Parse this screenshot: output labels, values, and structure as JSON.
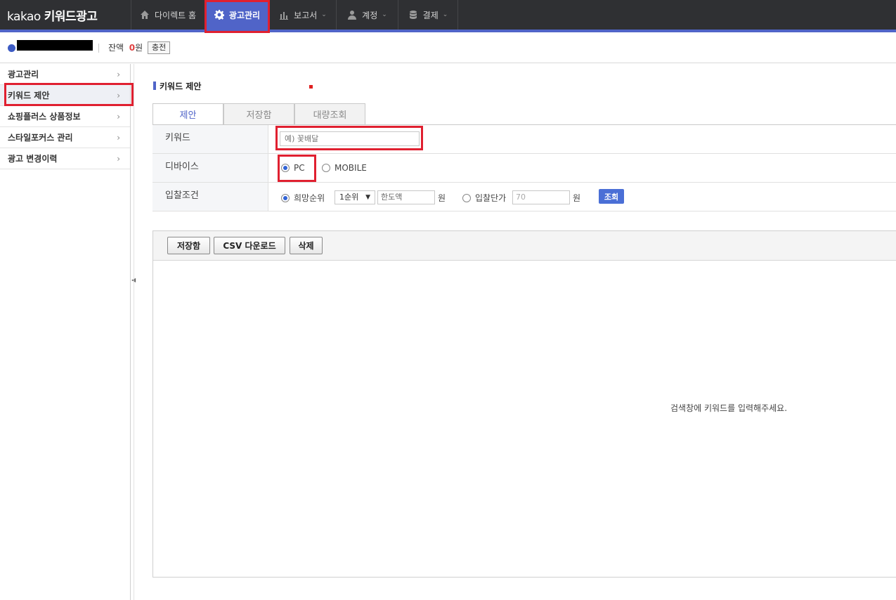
{
  "brand": {
    "logo_light": "kakao",
    "logo_bold": "키워드광고"
  },
  "nav": [
    {
      "label": "다이렉트 홈",
      "icon": "home-icon"
    },
    {
      "label": "광고관리",
      "icon": "gear-icon",
      "active": true
    },
    {
      "label": "보고서",
      "icon": "bar-chart-icon"
    },
    {
      "label": "계정",
      "icon": "user-icon"
    },
    {
      "label": "결제",
      "icon": "database-icon"
    }
  ],
  "account": {
    "balance_label": "잔액",
    "balance_value": "0",
    "balance_unit": "원",
    "charge_label": "충전"
  },
  "sidebar": {
    "items": [
      {
        "label": "광고관리"
      },
      {
        "label": "키워드 제안",
        "selected": true
      },
      {
        "label": "쇼핑플러스 상품정보"
      },
      {
        "label": "스타일포커스 관리"
      },
      {
        "label": "광고 변경이력"
      }
    ]
  },
  "main": {
    "title": "키워드 제안",
    "tabs": [
      {
        "label": "제안",
        "active": true
      },
      {
        "label": "저장함"
      },
      {
        "label": "대량조회"
      }
    ],
    "form": {
      "keyword_label": "키워드",
      "keyword_placeholder": "예) 꽃배달",
      "device_label": "디바이스",
      "device_options": [
        {
          "label": "PC",
          "checked": true
        },
        {
          "label": "MOBILE",
          "checked": false
        }
      ],
      "bid_label": "입찰조건",
      "bid_rank_label": "희망순위",
      "bid_rank_value": "1순위",
      "bid_limit_placeholder": "한도액",
      "bid_unit1": "원",
      "bid_price_label": "입찰단가",
      "bid_price_value": "70",
      "bid_unit2": "원",
      "query_button": "조회"
    },
    "result": {
      "buttons": [
        "저장함",
        "CSV 다운로드",
        "삭제"
      ],
      "empty_message": "검색창에 키워드를 입력해주세요."
    }
  },
  "colors": {
    "accent": "#5064c8",
    "highlight": "#e02030",
    "topbar": "#2f3033"
  }
}
